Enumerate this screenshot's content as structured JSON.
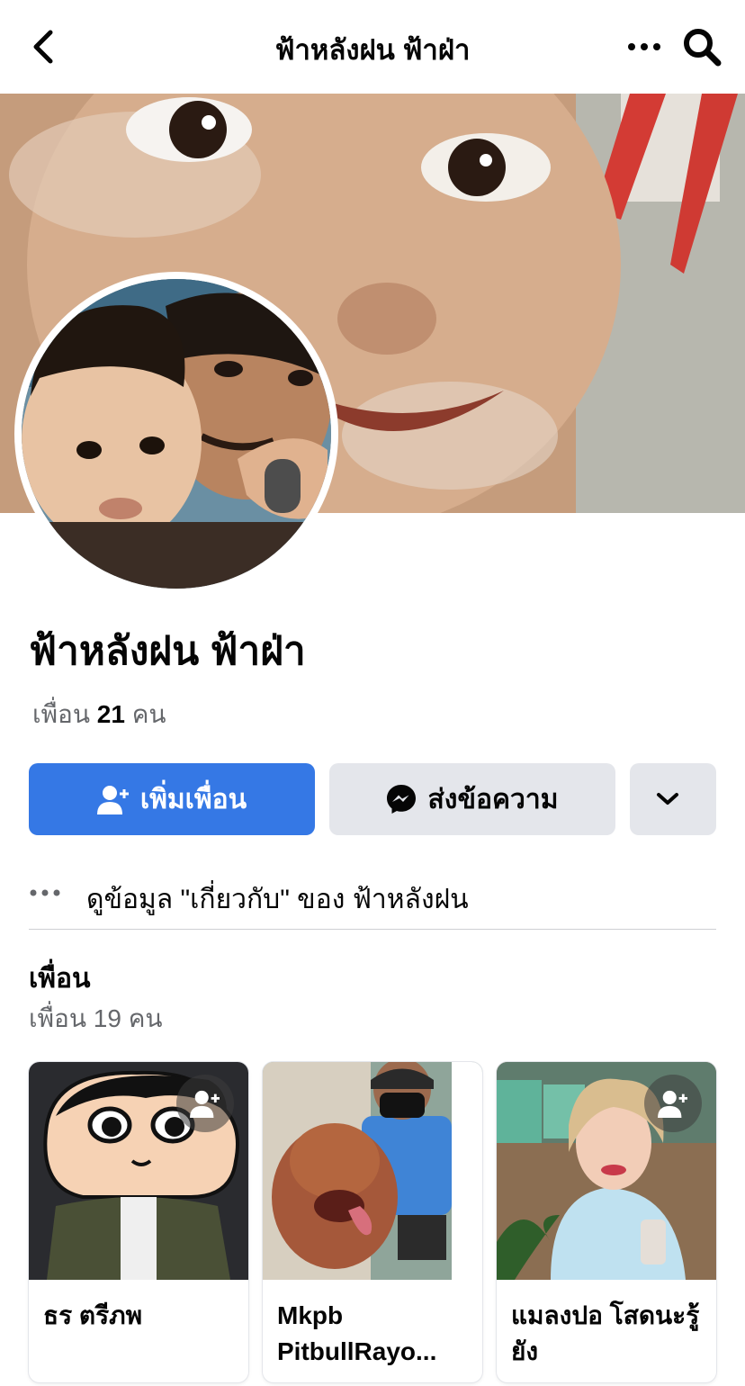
{
  "header": {
    "title": "ฟ้าหลังฝน ฟ้าฝ่า",
    "back_icon": "chevron-left-icon",
    "more_icon": "more-horizontal-icon",
    "search_icon": "search-icon"
  },
  "profile": {
    "name": "ฟ้าหลังฝน ฟ้าฝ่า",
    "friends_prefix": "เพื่อน",
    "friends_count": "21",
    "friends_suffix": "คน"
  },
  "actions": {
    "add_friend_label": "เพิ่มเพื่อน",
    "message_label": "ส่งข้อความ",
    "accent": "#3578e5"
  },
  "about": {
    "text": "ดูข้อมูล \"เกี่ยวกับ\" ของ ฟ้าหลังฝน"
  },
  "friends_section": {
    "title": "เพื่อน",
    "subtitle": "เพื่อน 19 คน",
    "cards": [
      {
        "name": "ธร ตรีภพ"
      },
      {
        "name": "Mkpb PitbullRayo..."
      },
      {
        "name": "แมลงปอ โสดนะรู้ยัง"
      }
    ]
  }
}
